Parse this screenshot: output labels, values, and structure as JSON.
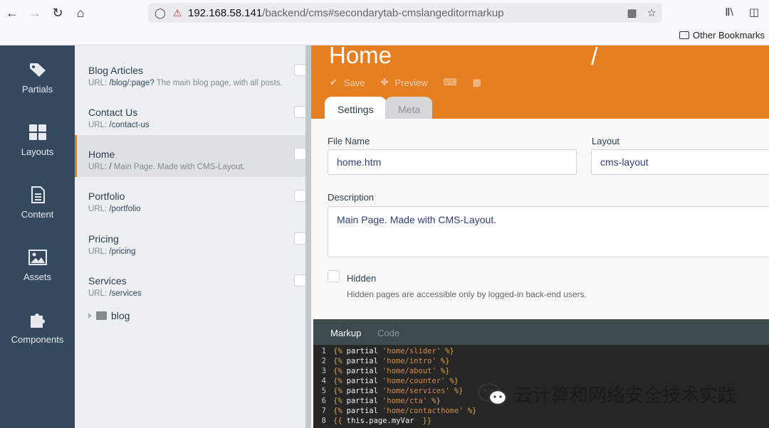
{
  "browser": {
    "url_host": "192.168.58.141",
    "url_path": "/backend/cms#secondarytab-cmslangeditormarkup",
    "bookmarks_label": "Other Bookmarks"
  },
  "sidenav": {
    "items": [
      {
        "label": "Partials",
        "icon": "tag-icon"
      },
      {
        "label": "Layouts",
        "icon": "grid-icon"
      },
      {
        "label": "Content",
        "icon": "document-icon"
      },
      {
        "label": "Assets",
        "icon": "image-icon"
      },
      {
        "label": "Components",
        "icon": "puzzle-icon"
      }
    ]
  },
  "pages": {
    "items": [
      {
        "title": "Blog Articles",
        "url_prefix": "URL:",
        "url": "/blog/:page?",
        "desc": " The main blog page, with all posts."
      },
      {
        "title": "Contact Us",
        "url_prefix": "URL:",
        "url": "/contact-us",
        "desc": ""
      },
      {
        "title": "Home",
        "url_prefix": "URL:",
        "url": "/",
        "desc": " Main Page. Made with CMS-Layout."
      },
      {
        "title": "Portfolio",
        "url_prefix": "URL:",
        "url": "/portfolio",
        "desc": ""
      },
      {
        "title": "Pricing",
        "url_prefix": "URL:",
        "url": "/pricing",
        "desc": ""
      },
      {
        "title": "Services",
        "url_prefix": "URL:",
        "url": "/services",
        "desc": ""
      }
    ],
    "folder": "blog"
  },
  "editor": {
    "title": "Home",
    "slash": "/",
    "actions": {
      "save": "Save",
      "preview": "Preview"
    },
    "tabs": {
      "settings": "Settings",
      "meta": "Meta"
    },
    "form": {
      "file_name_label": "File Name",
      "file_name_value": "home.htm",
      "layout_label": "Layout",
      "layout_value": "cms-layout",
      "description_label": "Description",
      "description_value": "Main Page. Made with CMS-Layout.",
      "hidden_label": "Hidden",
      "hidden_help": "Hidden pages are accessible only by logged-in back-end users."
    },
    "code_tabs": {
      "markup": "Markup",
      "code": "Code"
    },
    "code_lines": [
      {
        "n": "1",
        "open": "{%",
        "kw": "partial",
        "str": "'home/slider'",
        "close": "%}"
      },
      {
        "n": "2",
        "open": "{%",
        "kw": "partial",
        "str": "'home/intro'",
        "close": "%}"
      },
      {
        "n": "3",
        "open": "{%",
        "kw": "partial",
        "str": "'home/about'",
        "close": "%}"
      },
      {
        "n": "4",
        "open": "{%",
        "kw": "partial",
        "str": "'home/counter'",
        "close": "%}"
      },
      {
        "n": "5",
        "open": "{%",
        "kw": "partial",
        "str": "'home/services'",
        "close": "%}"
      },
      {
        "n": "6",
        "open": "{%",
        "kw": "partial",
        "str": "'home/cta'",
        "close": "%}"
      },
      {
        "n": "7",
        "open": "{%",
        "kw": "partial",
        "str": "'home/contacthome'",
        "close": "%}"
      },
      {
        "n": "8",
        "open": "{{",
        "kw": "this.page.myVar",
        "str": "",
        "close": "}}"
      }
    ]
  },
  "watermark": "云计算和网络安全技术实践",
  "colors": {
    "accent": "#e67e22",
    "sidenav": "#34495e",
    "list_bg": "#ecf0f1"
  }
}
